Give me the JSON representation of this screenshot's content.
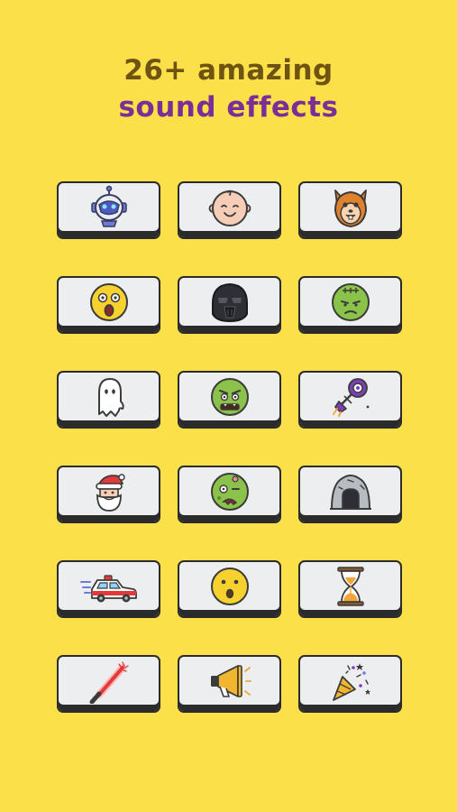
{
  "headline": {
    "line1": "26+ amazing",
    "line2": "sound effects"
  },
  "colors": {
    "background": "#fbe04a",
    "line1": "#6f5310",
    "line2": "#7b2e96",
    "button_face": "#eceeef",
    "button_border": "#2b2b2b"
  },
  "sound_buttons": [
    {
      "icon": "robot-icon"
    },
    {
      "icon": "baby-face-icon"
    },
    {
      "icon": "chipmunk-icon"
    },
    {
      "icon": "scared-face-icon"
    },
    {
      "icon": "dark-helmet-icon"
    },
    {
      "icon": "frankenstein-icon"
    },
    {
      "icon": "ghost-icon"
    },
    {
      "icon": "ogre-face-icon"
    },
    {
      "icon": "spaceship-icon"
    },
    {
      "icon": "santa-icon"
    },
    {
      "icon": "zombie-icon"
    },
    {
      "icon": "cave-icon"
    },
    {
      "icon": "police-car-icon"
    },
    {
      "icon": "surprised-face-icon"
    },
    {
      "icon": "hourglass-icon"
    },
    {
      "icon": "lightsaber-icon"
    },
    {
      "icon": "megaphone-icon"
    },
    {
      "icon": "party-popper-icon"
    }
  ]
}
